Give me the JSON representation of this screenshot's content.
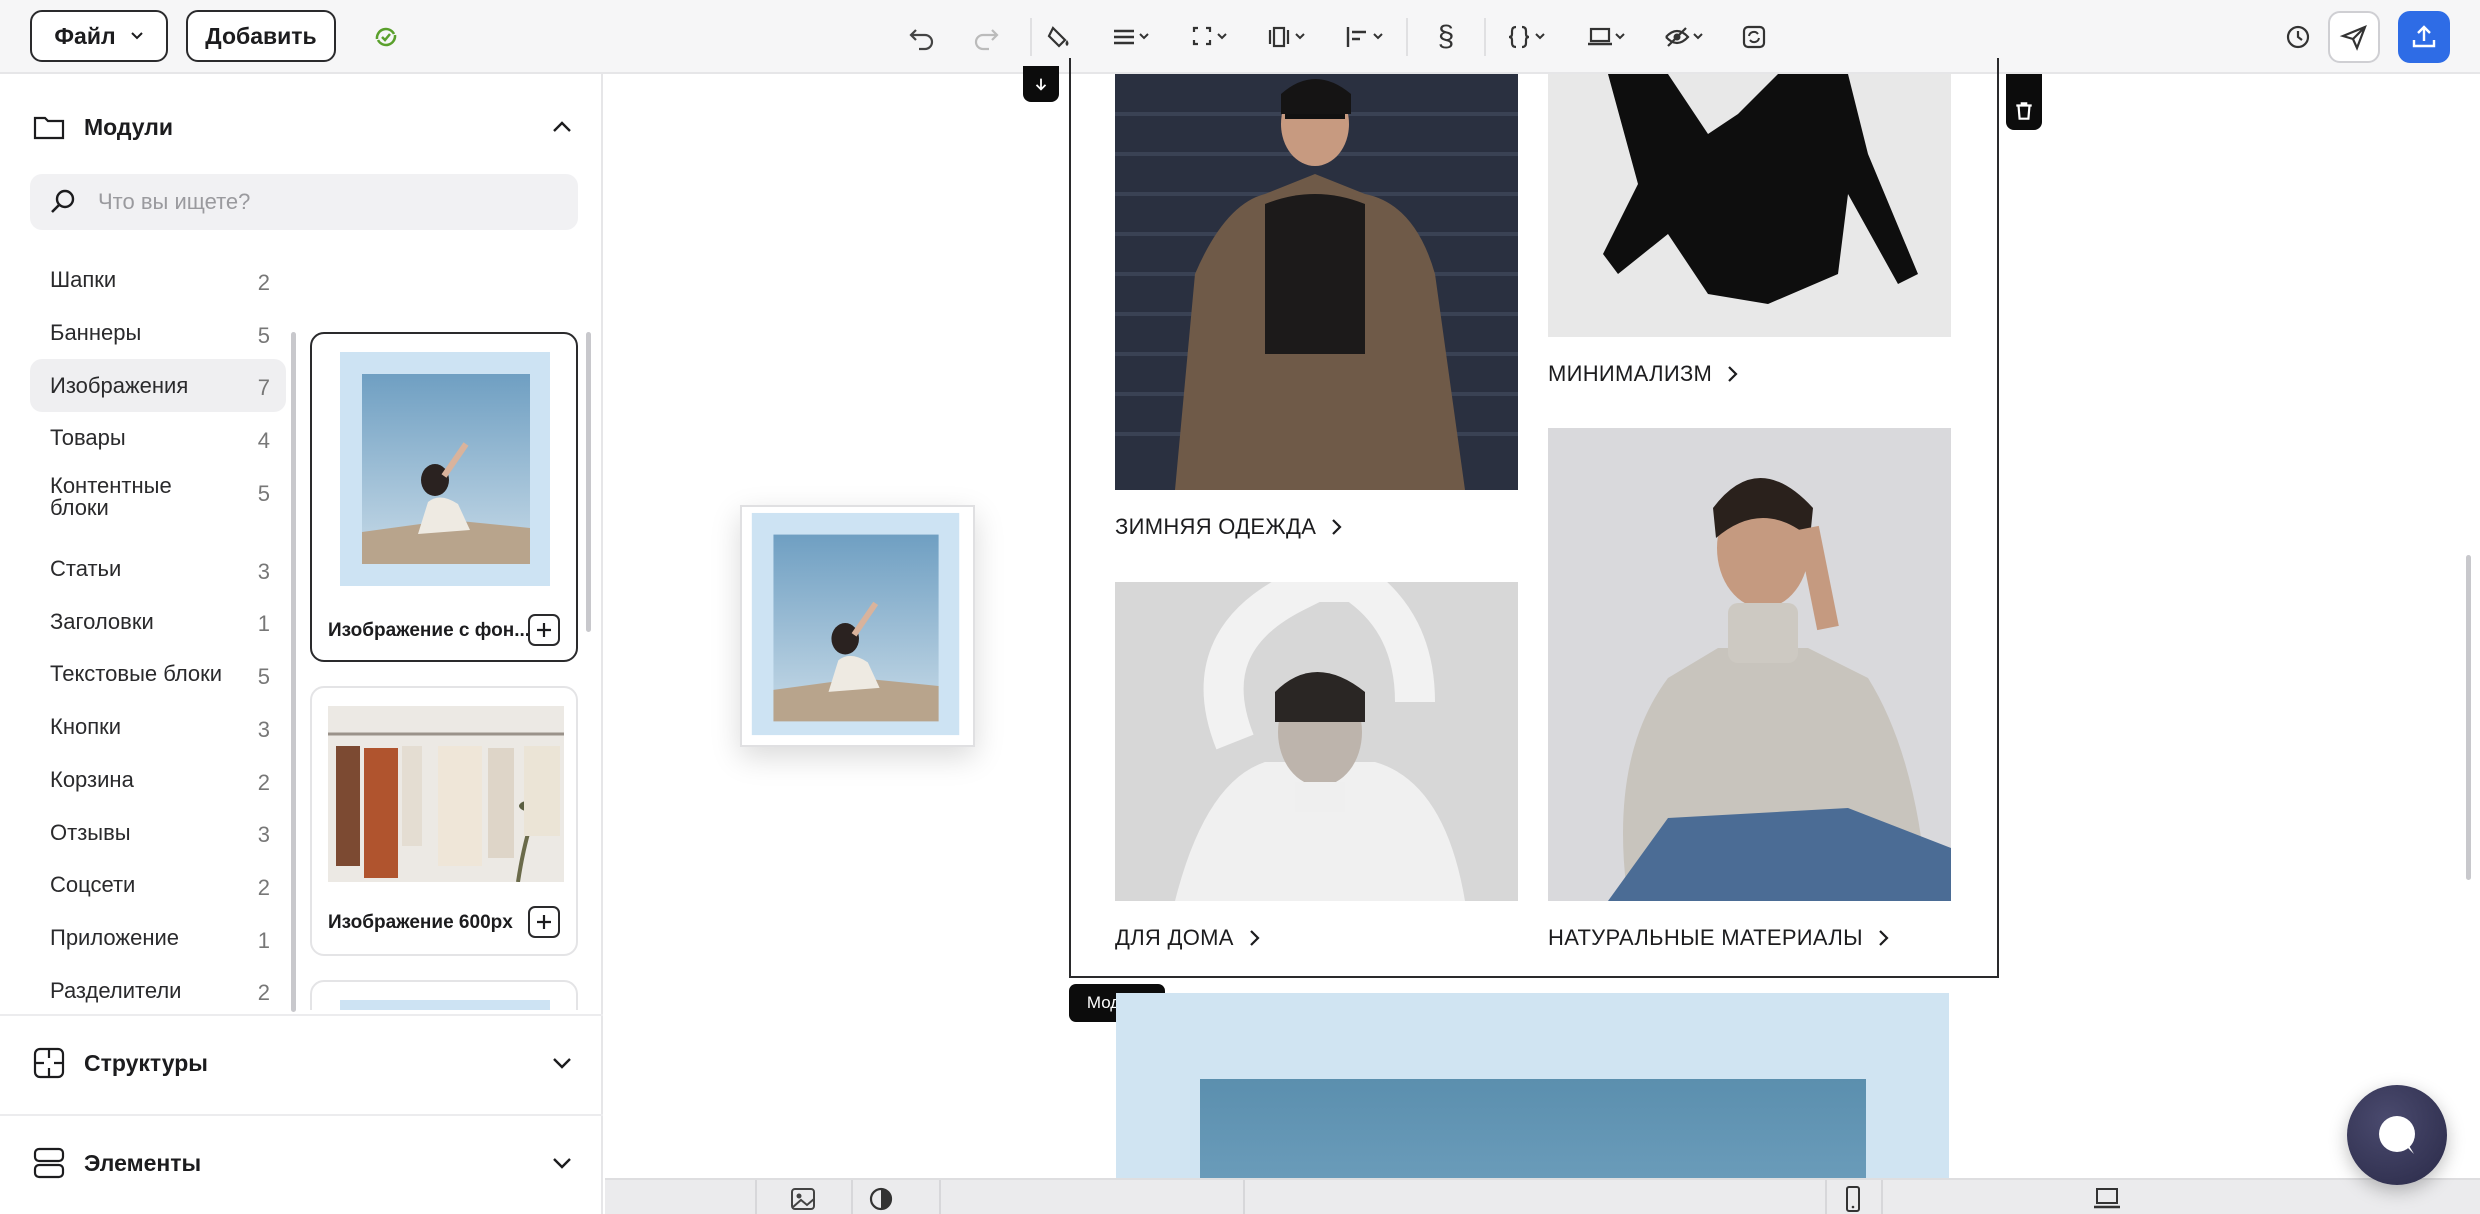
{
  "toolbar": {
    "file_label": "Файл",
    "add_label": "Добавить",
    "colors": {
      "sync": "#5aa02c",
      "publish": "#2e6ce6"
    }
  },
  "sidebar": {
    "modules_title": "Модули",
    "search_placeholder": "Что вы ищете?",
    "categories": [
      {
        "label": "Шапки",
        "count": "2"
      },
      {
        "label": "Баннеры",
        "count": "5"
      },
      {
        "label": "Изображения",
        "count": "7"
      },
      {
        "label": "Товары",
        "count": "4"
      },
      {
        "label": "Контентные блоки",
        "count": "5"
      },
      {
        "label": "Статьи",
        "count": "3"
      },
      {
        "label": "Заголовки",
        "count": "1"
      },
      {
        "label": "Текстовые блоки",
        "count": "5"
      },
      {
        "label": "Кнопки",
        "count": "3"
      },
      {
        "label": "Корзина",
        "count": "2"
      },
      {
        "label": "Отзывы",
        "count": "3"
      },
      {
        "label": "Соцсети",
        "count": "2"
      },
      {
        "label": "Приложение",
        "count": "1"
      },
      {
        "label": "Разделители",
        "count": "2"
      }
    ],
    "cards": [
      {
        "caption": "Изображение с фон..."
      },
      {
        "caption": "Изображение 600px"
      }
    ],
    "structures_title": "Структуры",
    "elements_title": "Элементы"
  },
  "canvas": {
    "links": {
      "winter": "ЗИМНЯЯ ОДЕЖДА",
      "minimalism": "МИНИМАЛИЗМ",
      "home": "ДЛЯ ДОМА",
      "natural": "НАТУРАЛЬНЫЕ МАТЕРИАЛЫ"
    },
    "module_tag": "Модуль",
    "banner_bg": "#d0e4f2",
    "banner_inner": "#5b8fae"
  }
}
